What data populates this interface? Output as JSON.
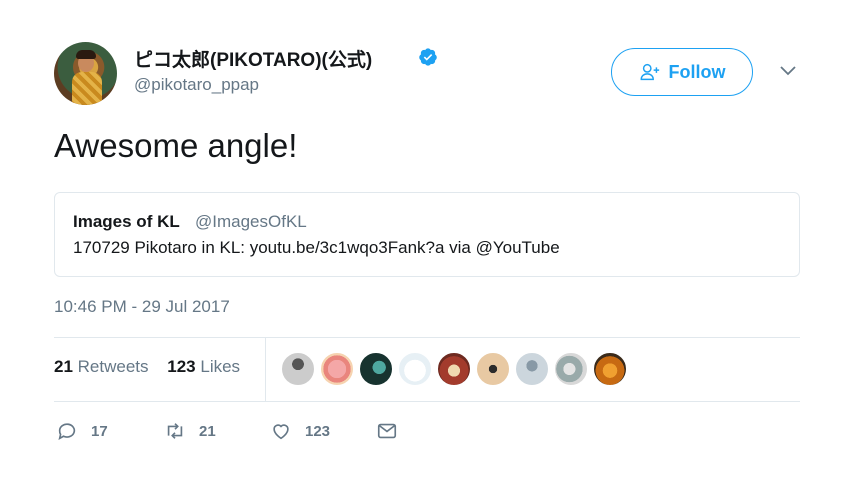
{
  "tweet": {
    "author": {
      "display_name": "ピコ太郎(PIKOTARO)(公式)",
      "handle": "@pikotaro_ppap",
      "verified": true
    },
    "follow_button_label": "Follow",
    "text": "Awesome angle!",
    "quoted": {
      "name": "Images of KL",
      "handle": "@ImagesOfKL",
      "text": "170729 Pikotaro in KL: youtu.be/3c1wqo3Fank?a via @YouTube"
    },
    "timestamp": "10:46 PM - 29 Jul 2017",
    "stats": {
      "retweets_count": "21",
      "retweets_label": "Retweets",
      "likes_count": "123",
      "likes_label": "Likes"
    },
    "actions": {
      "reply_count": "17",
      "retweet_count": "21",
      "like_count": "123"
    }
  },
  "colors": {
    "accent": "#1da1f2",
    "secondary_text": "#657786",
    "border": "#e1e8ed",
    "primary_text": "#14171a"
  },
  "icons": [
    "verified-badge-icon",
    "follow-user-plus-icon",
    "chevron-down-icon",
    "reply-icon",
    "retweet-icon",
    "like-heart-icon",
    "direct-message-icon"
  ]
}
